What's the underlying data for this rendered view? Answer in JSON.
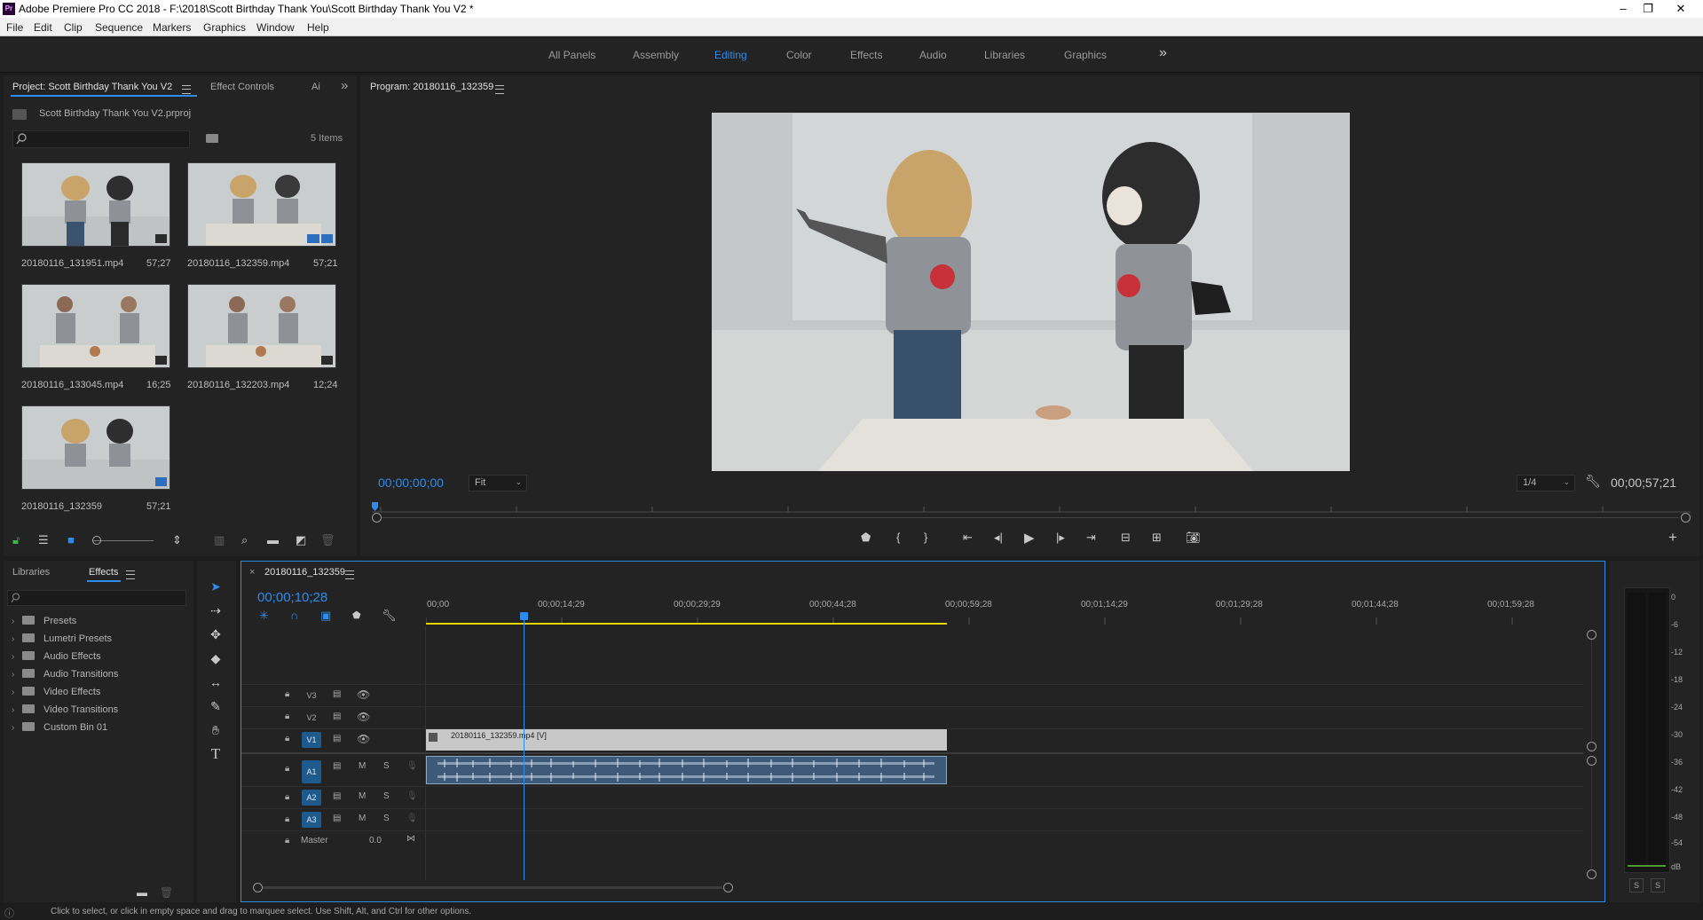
{
  "app": {
    "title": "Adobe Premiere Pro CC 2018 - F:\\2018\\Scott Birthday Thank You\\Scott Birthday Thank You V2 *",
    "logo_text": "Pr"
  },
  "window_buttons": {
    "minimize": "–",
    "restore": "❐",
    "close": "✕"
  },
  "menu": [
    "File",
    "Edit",
    "Clip",
    "Sequence",
    "Markers",
    "Graphics",
    "Window",
    "Help"
  ],
  "workspaces": {
    "items": [
      "All Panels",
      "Assembly",
      "Editing",
      "Color",
      "Effects",
      "Audio",
      "Libraries",
      "Graphics"
    ],
    "active": "Editing",
    "overflow": "»"
  },
  "project_panel": {
    "tabs": [
      "Project: Scott Birthday Thank You V2",
      "Effect Controls",
      "Ai"
    ],
    "overflow": "»",
    "file": "Scott Birthday Thank You V2.prproj",
    "item_count": "5 Items",
    "items": [
      {
        "name": "20180116_131951.mp4",
        "duration": "57;27"
      },
      {
        "name": "20180116_132359.mp4",
        "duration": "57;21"
      },
      {
        "name": "20180116_133045.mp4",
        "duration": "16;25"
      },
      {
        "name": "20180116_132203.mp4",
        "duration": "12;24"
      },
      {
        "name": "20180116_132359",
        "duration": "57;21"
      }
    ]
  },
  "program_monitor": {
    "title": "Program: 20180116_132359",
    "current_timecode": "00;00;00;00",
    "fit": "Fit",
    "resolution": "1/4",
    "duration_timecode": "00;00;57;21",
    "add_button": "+"
  },
  "effects_panel": {
    "tabs": [
      "Libraries",
      "Effects"
    ],
    "active_tab": "Effects",
    "tree": [
      "Presets",
      "Lumetri Presets",
      "Audio Effects",
      "Audio Transitions",
      "Video Effects",
      "Video Transitions",
      "Custom Bin 01"
    ]
  },
  "timeline": {
    "sequence_name": "20180116_132359",
    "close": "×",
    "playhead_timecode": "00;00;10;28",
    "ruler": [
      "00;00",
      "00;00;14;29",
      "00;00;29;29",
      "00;00;44;28",
      "00;00;59;28",
      "00;01;14;29",
      "00;01;29;28",
      "00;01;44;28",
      "00;01;59;28"
    ],
    "video_tracks": [
      "V3",
      "V2",
      "V1"
    ],
    "audio_tracks": [
      "A1",
      "A2",
      "A3"
    ],
    "master_label": "Master",
    "master_value": "0.0",
    "mute_label": "M",
    "solo_label": "S",
    "clip_label": "20180116_132359.mp4 [V]"
  },
  "audio_meter": {
    "scale": [
      "0",
      "-6",
      "-12",
      "-18",
      "-24",
      "-30",
      "-36",
      "-42",
      "-48",
      "-54",
      "dB"
    ],
    "solo_buttons": [
      "S",
      "S"
    ]
  },
  "status_bar": "Click to select, or click in empty space and drag to marquee select. Use Shift, Alt, and Ctrl for other options.",
  "colors": {
    "accent": "#2d8ceb",
    "panel": "#232323",
    "background": "#1d1d1d",
    "clip_video": "#c8c8c8",
    "clip_audio": "#3d5a7a",
    "work_area": "#e8d400"
  },
  "icons": [
    "search-icon",
    "new-bin-icon",
    "play-icon",
    "step-back-icon",
    "step-forward-icon",
    "wrench-icon",
    "camera-icon",
    "selection-tool-icon",
    "razor-tool-icon",
    "hand-tool-icon",
    "type-tool-icon",
    "lock-icon",
    "eye-icon",
    "folder-icon",
    "chevron-right-icon"
  ]
}
